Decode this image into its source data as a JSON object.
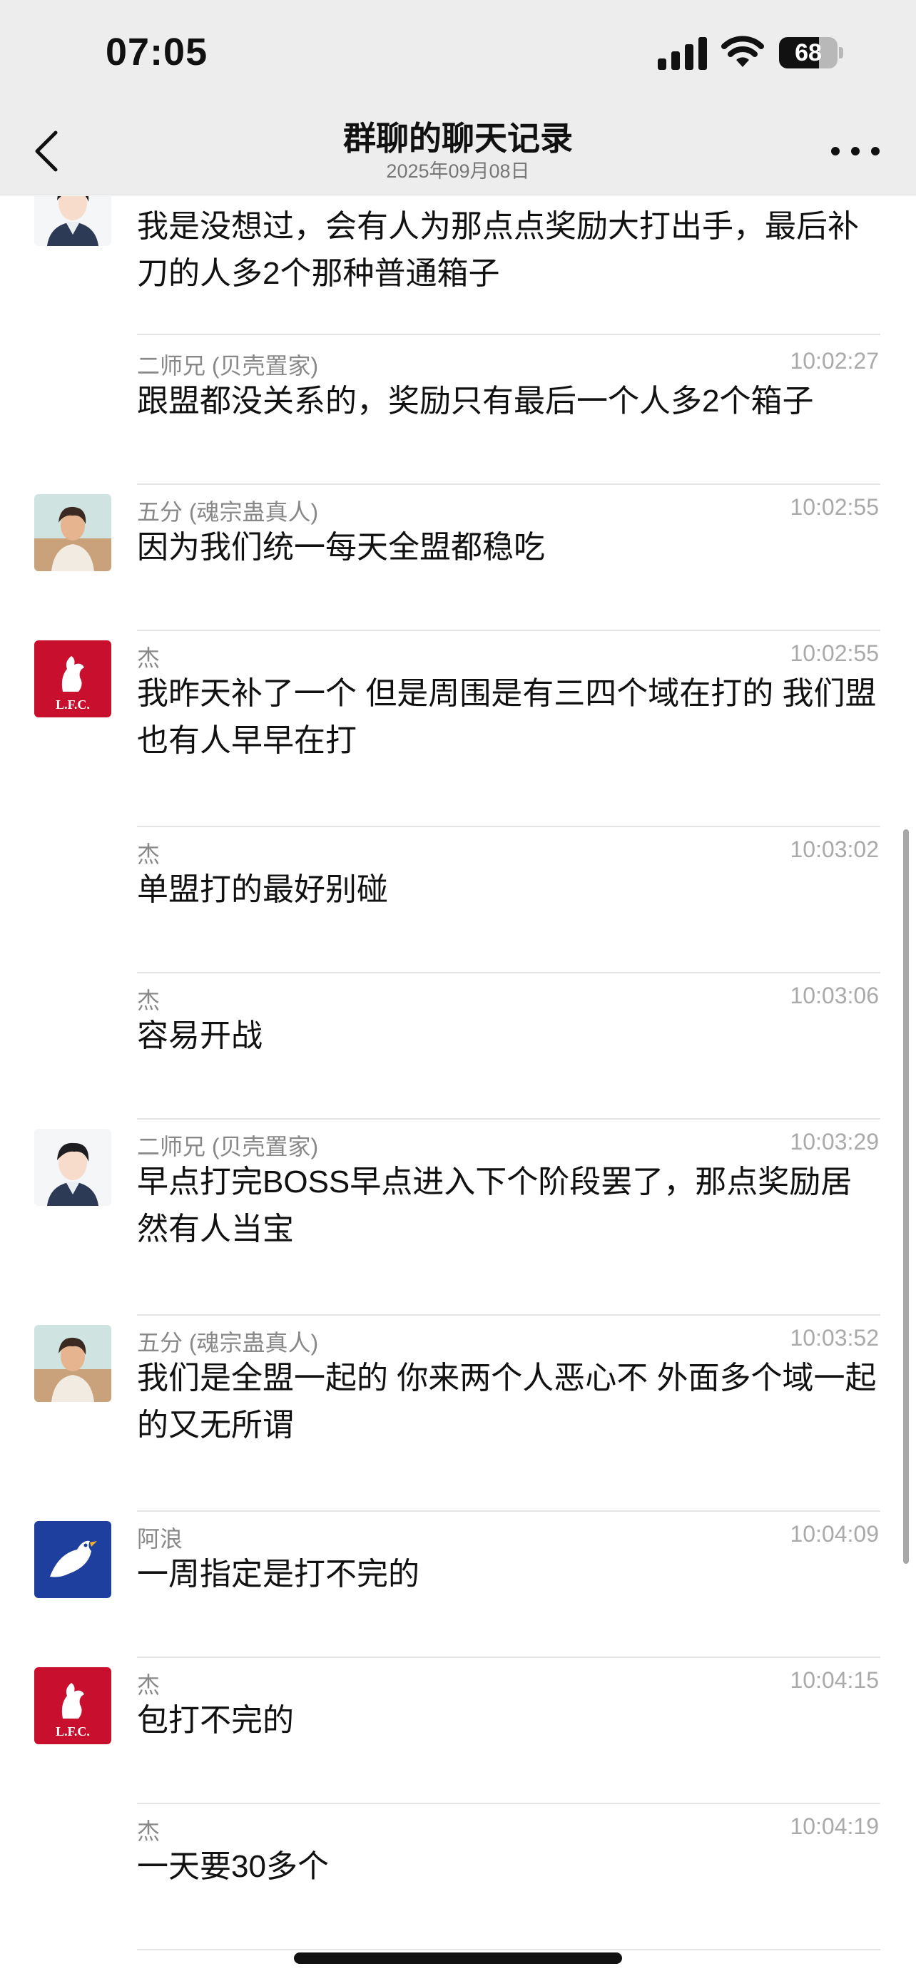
{
  "status_bar": {
    "time": "07:05",
    "battery": "68",
    "battery_level": 0.68,
    "icons": [
      "cellular-signal-icon",
      "wifi-icon",
      "battery-icon"
    ]
  },
  "nav": {
    "title": "群聊的聊天记录",
    "subtitle": "2025年09月08日",
    "icons": [
      "back-chevron-icon",
      "more-dots-icon"
    ]
  },
  "messages": [
    {
      "sender": "",
      "time": "",
      "text": "我是没想过，会有人为那点点奖励大打出手，最后补刀的人多2个那种普通箱子",
      "avatar": "boy-avatar"
    },
    {
      "sender": "二师兄 (贝壳置家)",
      "time": "10:02:27",
      "text": "跟盟都没关系的，奖励只有最后一个人多2个箱子",
      "avatar": ""
    },
    {
      "sender": "五分 (魂宗蛊真人)",
      "time": "10:02:55",
      "text": "因为我们统一每天全盟都稳吃",
      "avatar": "illustrated-man-avatar"
    },
    {
      "sender": "杰",
      "time": "10:02:55",
      "text": "我昨天补了一个  但是周围是有三四个域在打的 我们盟也有人早早在打",
      "avatar": "lfc-logo-avatar"
    },
    {
      "sender": "杰",
      "time": "10:03:02",
      "text": "单盟打的最好别碰",
      "avatar": ""
    },
    {
      "sender": "杰",
      "time": "10:03:06",
      "text": "容易开战",
      "avatar": ""
    },
    {
      "sender": "二师兄 (贝壳置家)",
      "time": "10:03:29",
      "text": "早点打完BOSS早点进入下个阶段罢了，那点奖励居然有人当宝",
      "avatar": "boy-avatar"
    },
    {
      "sender": "五分 (魂宗蛊真人)",
      "time": "10:03:52",
      "text": "我们是全盟一起的 你来两个人恶心不 外面多个域一起的又无所谓",
      "avatar": "illustrated-man-avatar"
    },
    {
      "sender": "阿浪",
      "time": "10:04:09",
      "text": "一周指定是打不完的",
      "avatar": "bird-avatar"
    },
    {
      "sender": "杰",
      "time": "10:04:15",
      "text": "包打不完的",
      "avatar": "lfc-logo-avatar"
    },
    {
      "sender": "杰",
      "time": "10:04:19",
      "text": "一天要30多个",
      "avatar": ""
    }
  ],
  "colors": {
    "bar_background": "#ededed",
    "text": "#111111",
    "meta_text": "#888888",
    "lfc_red": "#c8102e",
    "bird_blue": "#1f3f9e"
  }
}
